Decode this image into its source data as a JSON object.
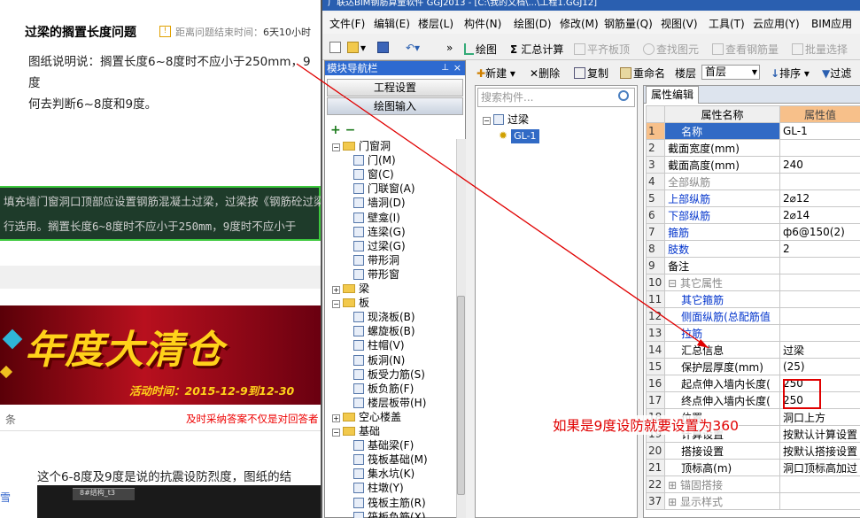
{
  "web": {
    "question_title": "过梁的搁置长度问题",
    "time_label": "距离问题结束时间：",
    "time_value": "6天10小时",
    "body_line1": "图纸说明说：搁置长度6~8度时不应小于250mm，9度",
    "body_line2": "何去判断6~8度和9度。",
    "code_line1": "填充墙门窗洞口顶部应设置钢筋混凝土过梁，过梁按《钢筋砼过梁",
    "code_line2": "行选用。搁置长度6~8度时不应小于250mm，9度时不应小于",
    "banner_title": "年度大清仓",
    "banner_date": "活动时间：2015-12-9到12-30",
    "tiao": "条",
    "adopt_note": "及时采纳答案不仅是对回答者",
    "answer_text": "这个6-8度及9度是说的抗震设防烈度，图纸的结",
    "side_link": "雪",
    "thumb_title": "8#结构_t3"
  },
  "app": {
    "title_bar": "广联达BIM钢筋算量软件 GGJ2013 - [C:\\我的文档\\...\\工程1.GGJ12]",
    "menus": [
      "文件(F)",
      "编辑(E)",
      "楼层(L)",
      "构件(N)",
      "绘图(D)",
      "修改(M)",
      "钢筋量(Q)",
      "视图(V)",
      "工具(T)",
      "云应用(Y)",
      "BIM应用"
    ],
    "toolbar": {
      "draw": "绘图",
      "sum": "汇总计算",
      "flat_board": "平齐板顶",
      "find": "查找图元",
      "view_rebar": "查看钢筋量",
      "batch_select": "批量选择"
    },
    "nav": {
      "header": "模块导航栏",
      "btn_project": "工程设置",
      "btn_draw": "绘图输入",
      "tree": [
        {
          "label": "门窗洞",
          "kind": "folder",
          "exp": "-"
        },
        {
          "label": "门(M)",
          "kind": "leaf"
        },
        {
          "label": "窗(C)",
          "kind": "leaf"
        },
        {
          "label": "门联窗(A)",
          "kind": "leaf"
        },
        {
          "label": "墙洞(D)",
          "kind": "leaf"
        },
        {
          "label": "壁龛(I)",
          "kind": "leaf"
        },
        {
          "label": "连梁(G)",
          "kind": "leaf"
        },
        {
          "label": "过梁(G)",
          "kind": "leaf"
        },
        {
          "label": "带形洞",
          "kind": "leaf"
        },
        {
          "label": "带形窗",
          "kind": "leaf"
        },
        {
          "label": "梁",
          "kind": "folder",
          "exp": "+"
        },
        {
          "label": "板",
          "kind": "folder",
          "exp": "-"
        },
        {
          "label": "现浇板(B)",
          "kind": "leaf"
        },
        {
          "label": "螺旋板(B)",
          "kind": "leaf"
        },
        {
          "label": "柱帽(V)",
          "kind": "leaf"
        },
        {
          "label": "板洞(N)",
          "kind": "leaf"
        },
        {
          "label": "板受力筋(S)",
          "kind": "leaf"
        },
        {
          "label": "板负筋(F)",
          "kind": "leaf"
        },
        {
          "label": "楼层板带(H)",
          "kind": "leaf"
        },
        {
          "label": "空心楼盖",
          "kind": "folder",
          "exp": "+"
        },
        {
          "label": "基础",
          "kind": "folder",
          "exp": "-"
        },
        {
          "label": "基础梁(F)",
          "kind": "leaf"
        },
        {
          "label": "筏板基础(M)",
          "kind": "leaf"
        },
        {
          "label": "集水坑(K)",
          "kind": "leaf"
        },
        {
          "label": "柱墩(Y)",
          "kind": "leaf"
        },
        {
          "label": "筏板主筋(R)",
          "kind": "leaf"
        },
        {
          "label": "筏板负筋(X)",
          "kind": "leaf"
        }
      ]
    },
    "toolbar2": {
      "new": "新建",
      "delete": "删除",
      "copy": "复制",
      "rename": "重命名",
      "floor_label": "楼层",
      "floor_value": "首层",
      "sort": "排序",
      "filter": "过滤"
    },
    "components": {
      "search_placeholder": "搜索构件...",
      "root": "过梁",
      "item": "GL-1"
    },
    "props": {
      "tab": "属性编辑",
      "col_name": "属性名称",
      "col_value": "属性值",
      "rows": [
        {
          "n": "1",
          "name": "名称",
          "value": "GL-1",
          "style": "sel"
        },
        {
          "n": "2",
          "name": "截面宽度(mm)",
          "value": "",
          "style": ""
        },
        {
          "n": "3",
          "name": "截面高度(mm)",
          "value": "240",
          "style": ""
        },
        {
          "n": "4",
          "name": "全部纵筋",
          "value": "",
          "style": "gray"
        },
        {
          "n": "5",
          "name": "上部纵筋",
          "value": "2⌀12",
          "style": "blue"
        },
        {
          "n": "6",
          "name": "下部纵筋",
          "value": "2⌀14",
          "style": "blue"
        },
        {
          "n": "7",
          "name": "箍筋",
          "value": "ф6@150(2)",
          "style": "blue"
        },
        {
          "n": "8",
          "name": "肢数",
          "value": "2",
          "style": "blue"
        },
        {
          "n": "9",
          "name": "备注",
          "value": "",
          "style": ""
        },
        {
          "n": "10",
          "name": "⊟ 其它属性",
          "value": "",
          "style": "gray"
        },
        {
          "n": "11",
          "name": "其它箍筋",
          "value": "",
          "style": "blue ind"
        },
        {
          "n": "12",
          "name": "侧面纵筋(总配筋值",
          "value": "",
          "style": "blue ind"
        },
        {
          "n": "13",
          "name": "拉筋",
          "value": "",
          "style": "blue ind"
        },
        {
          "n": "14",
          "name": "汇总信息",
          "value": "过梁",
          "style": "ind"
        },
        {
          "n": "15",
          "name": "保护层厚度(mm)",
          "value": "(25)",
          "style": "ind"
        },
        {
          "n": "16",
          "name": "起点伸入墙内长度(",
          "value": "250",
          "style": "ind"
        },
        {
          "n": "17",
          "name": "终点伸入墙内长度(",
          "value": "250",
          "style": "ind"
        },
        {
          "n": "18",
          "name": "位置",
          "value": "洞口上方",
          "style": "ind"
        },
        {
          "n": "19",
          "name": "计算设置",
          "value": "按默认计算设置",
          "style": "ind"
        },
        {
          "n": "20",
          "name": "搭接设置",
          "value": "按默认搭接设置",
          "style": "ind"
        },
        {
          "n": "21",
          "name": "顶标高(m)",
          "value": "洞口顶标高加过",
          "style": "ind"
        },
        {
          "n": "22",
          "name": "⊞ 锚固搭接",
          "value": "",
          "style": "gray"
        },
        {
          "n": "37",
          "name": "⊞ 显示样式",
          "value": "",
          "style": "gray"
        }
      ]
    },
    "annotation": "如果是9度设防就要设置为360"
  },
  "colors": {
    "annotation": "#e00000",
    "selection": "#316ac5",
    "header_value": "#f7c08a",
    "nav_header": "#2e6ad0"
  }
}
